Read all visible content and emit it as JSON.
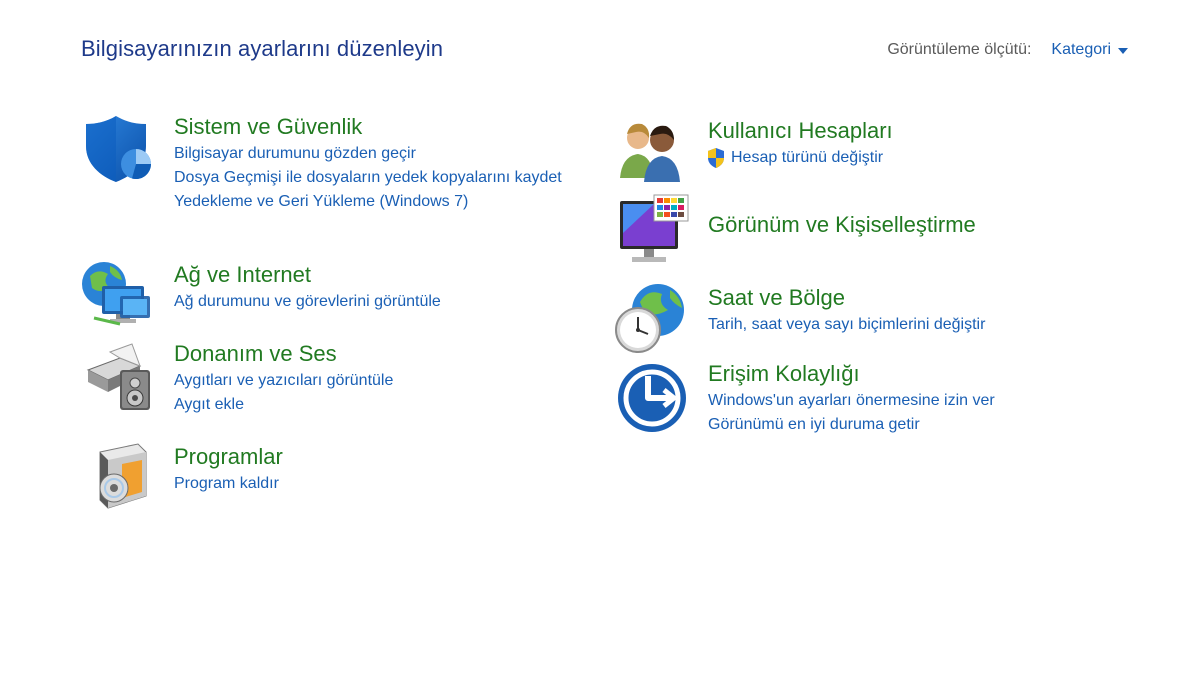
{
  "header": {
    "title": "Bilgisayarınızın ayarlarını düzenleyin",
    "view_by_label": "Görüntüleme ölçütü:",
    "view_by_value": "Kategori"
  },
  "categories": {
    "system": {
      "title": "Sistem ve Güvenlik",
      "icon": "security-shield-icon",
      "links": [
        "Bilgisayar durumunu gözden geçir",
        "Dosya Geçmişi ile dosyaların yedek kopyalarını kaydet",
        "Yedekleme ve Geri Yükleme (Windows 7)"
      ]
    },
    "network": {
      "title": "Ağ ve Internet",
      "icon": "network-globe-icon",
      "links": [
        "Ağ durumunu ve görevlerini görüntüle"
      ]
    },
    "hardware": {
      "title": "Donanım ve Ses",
      "icon": "printer-speaker-icon",
      "links": [
        "Aygıtları ve yazıcıları görüntüle",
        "Aygıt ekle"
      ]
    },
    "programs": {
      "title": "Programlar",
      "icon": "programs-box-icon",
      "links": [
        "Program kaldır"
      ]
    },
    "users": {
      "title": "Kullanıcı Hesapları",
      "icon": "user-accounts-icon",
      "links": [
        "Hesap türünü değiştir"
      ]
    },
    "appearance": {
      "title": "Görünüm ve Kişiselleştirme",
      "icon": "monitor-palette-icon",
      "links": []
    },
    "clock": {
      "title": "Saat ve Bölge",
      "icon": "clock-globe-icon",
      "links": [
        "Tarih, saat veya sayı biçimlerini değiştir"
      ]
    },
    "access": {
      "title": "Erişim Kolaylığı",
      "icon": "ease-of-access-icon",
      "links": [
        "Windows'un ayarları önermesine izin ver",
        "Görünümü en iyi duruma getir"
      ]
    }
  },
  "colors": {
    "category_title": "#217a21",
    "link": "#1a5fb4",
    "heading": "#1e3a8a"
  }
}
